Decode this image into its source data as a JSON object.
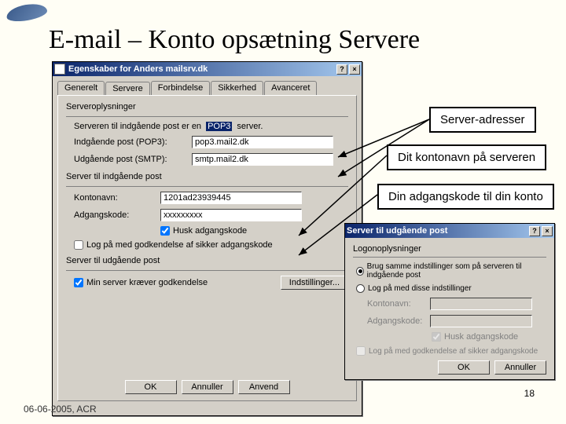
{
  "slide": {
    "title": "E-mail – Konto opsætning Servere",
    "footer": "06-06-2005, ACR",
    "slide_number": "18"
  },
  "callouts": {
    "c1": "Server-adresser",
    "c2": "Dit kontonavn på serveren",
    "c3": "Din adgangskode til din konto"
  },
  "win1": {
    "title": "Egenskaber for Anders mailsrv.dk",
    "help": "?",
    "close": "×",
    "tabs": [
      "Generelt",
      "Servere",
      "Forbindelse",
      "Sikkerhed",
      "Avanceret"
    ],
    "active_tab": 1,
    "groups": {
      "server_info": {
        "title": "Serveroplysninger",
        "r1a": "Serveren til indgående post er en",
        "r1val": "POP3",
        "r1b": "server.",
        "r2": "Indgående post (POP3):",
        "r2val": "pop3.mail2.dk",
        "r3": "Udgående post (SMTP):",
        "r3val": "smtp.mail2.dk"
      },
      "incoming": {
        "title": "Server til indgående post",
        "acct": "Kontonavn:",
        "acct_val": "1201ad23939445",
        "pw": "Adgangskode:",
        "pw_val": "xxxxxxxxx",
        "remember": "Husk adgangskode",
        "secure": "Log på med godkendelse af sikker adgangskode"
      },
      "outgoing": {
        "title": "Server til udgående post",
        "auth": "Min server kræver godkendelse",
        "settings_btn": "Indstillinger..."
      }
    },
    "btns": {
      "ok": "OK",
      "cancel": "Annuller",
      "apply": "Anvend"
    }
  },
  "win2": {
    "title": "Server til udgående post",
    "help": "?",
    "close": "×",
    "group": "Logonoplysninger",
    "opt1": "Brug samme indstillinger som på serveren til indgående post",
    "opt2": "Log på med disse indstillinger",
    "acct": "Kontonavn:",
    "pw": "Adgangskode:",
    "remember": "Husk adgangskode",
    "secure": "Log på med godkendelse af sikker adgangskode",
    "btns": {
      "ok": "OK",
      "cancel": "Annuller"
    }
  }
}
